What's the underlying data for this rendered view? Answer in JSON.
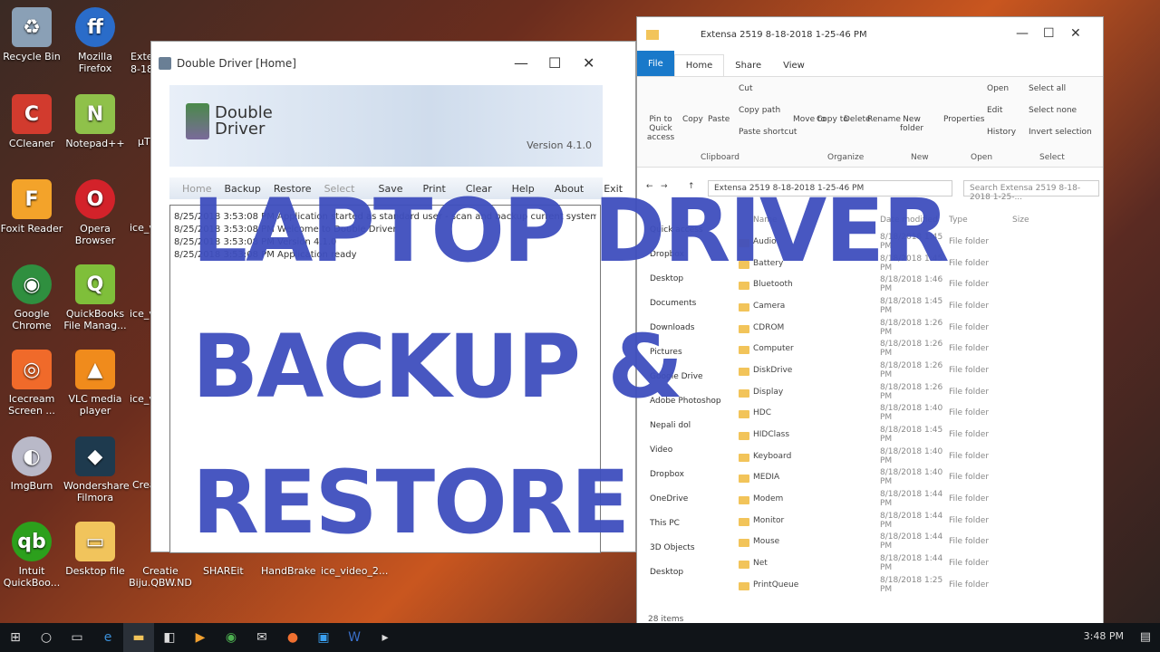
{
  "desktop": {
    "icons": [
      {
        "label": "Recycle Bin",
        "icon": "recycle-bin-icon",
        "color": "#c9d6e3",
        "glyph": "♻"
      },
      {
        "label": "CCleaner",
        "icon": "ccleaner-icon",
        "color": "#d23b2e",
        "glyph": "C"
      },
      {
        "label": "Foxit Reader",
        "icon": "foxit-icon",
        "color": "#f3a32a",
        "glyph": "F"
      },
      {
        "label": "Google Chrome",
        "icon": "chrome-icon",
        "color": "#2f8f3f",
        "glyph": "◉"
      },
      {
        "label": "Icecream Screen ...",
        "icon": "icecream-icon",
        "color": "#f06a2a",
        "glyph": "◎"
      },
      {
        "label": "ImgBurn",
        "icon": "imgburn-icon",
        "color": "#b9b9c8",
        "glyph": "◐"
      },
      {
        "label": "Intuit QuickBoo...",
        "icon": "quickbooks-icon",
        "color": "#2ca01c",
        "glyph": "qb"
      }
    ],
    "icons2": [
      {
        "label": "Mozilla Firefox",
        "icon": "firefox-icon",
        "color": "#2a6cc9",
        "glyph": "ff"
      },
      {
        "label": "Notepad++",
        "icon": "notepadpp-icon",
        "color": "#8fc14a",
        "glyph": "N"
      },
      {
        "label": "Opera Browser",
        "icon": "opera-icon",
        "color": "#d3222a",
        "glyph": "O"
      },
      {
        "label": "QuickBooks File Manag...",
        "icon": "quickbooks-file-icon",
        "color": "#7fbf3a",
        "glyph": "Q"
      },
      {
        "label": "VLC media player",
        "icon": "vlc-icon",
        "color": "#f08b1c",
        "glyph": "▲"
      },
      {
        "label": "Wondershare Filmora",
        "icon": "filmora-icon",
        "color": "#1e3a4e",
        "glyph": "◆"
      },
      {
        "label": "Desktop file",
        "icon": "folder-icon",
        "color": "#f1c45c",
        "glyph": "▭"
      }
    ],
    "partials": [
      "Exte",
      "8-18",
      "µT",
      "ice_v",
      "ice_v",
      "ice_v",
      "Crea"
    ],
    "bottom_row": [
      "Creatie Biju.QBW.ND",
      "SHAREit",
      "HandBrake",
      "ice_video_2..."
    ]
  },
  "double_driver": {
    "title": "Double Driver [Home]",
    "logo_line1": "Double",
    "logo_line2": "Driver",
    "version": "Version 4.1.0",
    "menu": [
      "Home",
      "Backup",
      "Restore",
      "Select",
      "Save",
      "Print",
      "Clear",
      "Help",
      "About",
      "Exit"
    ],
    "log_lines": [
      "8/25/2018 3:53:08 PM  Application started as standard user - scan and backup current system only>",
      "8/25/2018 3:53:08 PM  Welcome to Double Driver",
      "8/25/2018 3:53:08 PM  Version 4.1.0",
      "8/25/2018 3:53:08 PM  Application ready"
    ]
  },
  "explorer": {
    "title": "Extensa 2519 8-18-2018 1-25-46 PM",
    "tabs": [
      "File",
      "Home",
      "Share",
      "View"
    ],
    "ribbon": {
      "buttons": [
        "Pin to Quick access",
        "Copy",
        "Paste",
        "Cut",
        "Copy path",
        "Paste shortcut",
        "Move to",
        "Copy to",
        "Delete",
        "Rename",
        "New folder",
        "Properties",
        "Open",
        "Edit",
        "History",
        "Select all",
        "Select none",
        "Invert selection"
      ],
      "groups": [
        "Clipboard",
        "Organize",
        "New",
        "Open",
        "Select"
      ]
    },
    "address": "Extensa 2519 8-18-2018 1-25-46 PM",
    "search_placeholder": "Search Extensa 2519 8-18-2018 1-25-...",
    "columns": [
      "Name",
      "Date modified",
      "Type",
      "Size"
    ],
    "nav": [
      "Quick access",
      "Dropbox",
      "Desktop",
      "Documents",
      "Downloads",
      "Pictures",
      "Google Drive",
      "Adobe Photoshop",
      "Nepali dol",
      "Video",
      "Dropbox",
      "OneDrive",
      "This PC",
      "3D Objects",
      "Desktop"
    ],
    "files": [
      {
        "name": "Audio",
        "date": "8/18/2018 1:45 PM",
        "type": "File folder"
      },
      {
        "name": "Battery",
        "date": "8/18/2018 1:45 PM",
        "type": "File folder"
      },
      {
        "name": "Bluetooth",
        "date": "8/18/2018 1:46 PM",
        "type": "File folder"
      },
      {
        "name": "Camera",
        "date": "8/18/2018 1:45 PM",
        "type": "File folder"
      },
      {
        "name": "CDROM",
        "date": "8/18/2018 1:26 PM",
        "type": "File folder"
      },
      {
        "name": "Computer",
        "date": "8/18/2018 1:26 PM",
        "type": "File folder"
      },
      {
        "name": "DiskDrive",
        "date": "8/18/2018 1:26 PM",
        "type": "File folder"
      },
      {
        "name": "Display",
        "date": "8/18/2018 1:26 PM",
        "type": "File folder"
      },
      {
        "name": "HDC",
        "date": "8/18/2018 1:40 PM",
        "type": "File folder"
      },
      {
        "name": "HIDClass",
        "date": "8/18/2018 1:45 PM",
        "type": "File folder"
      },
      {
        "name": "Keyboard",
        "date": "8/18/2018 1:40 PM",
        "type": "File folder"
      },
      {
        "name": "MEDIA",
        "date": "8/18/2018 1:40 PM",
        "type": "File folder"
      },
      {
        "name": "Modem",
        "date": "8/18/2018 1:44 PM",
        "type": "File folder"
      },
      {
        "name": "Monitor",
        "date": "8/18/2018 1:44 PM",
        "type": "File folder"
      },
      {
        "name": "Mouse",
        "date": "8/18/2018 1:44 PM",
        "type": "File folder"
      },
      {
        "name": "Net",
        "date": "8/18/2018 1:44 PM",
        "type": "File folder"
      },
      {
        "name": "PrintQueue",
        "date": "8/18/2018 1:25 PM",
        "type": "File folder"
      }
    ],
    "status": "28 items"
  },
  "headline": {
    "line1": "LAPTOP DRIVER",
    "line2": "BACKUP &",
    "line3": "RESTORE",
    "color": "#3f4fbe"
  },
  "taskbar": {
    "time": "3:48 PM",
    "icons": [
      "windows-start-icon",
      "search-icon",
      "task-view-icon",
      "edge-icon",
      "file-explorer-icon",
      "store-icon",
      "media-icon",
      "chrome-icon",
      "mail-icon",
      "podcast-icon",
      "app-icon",
      "word-icon",
      "terminal-icon"
    ]
  }
}
